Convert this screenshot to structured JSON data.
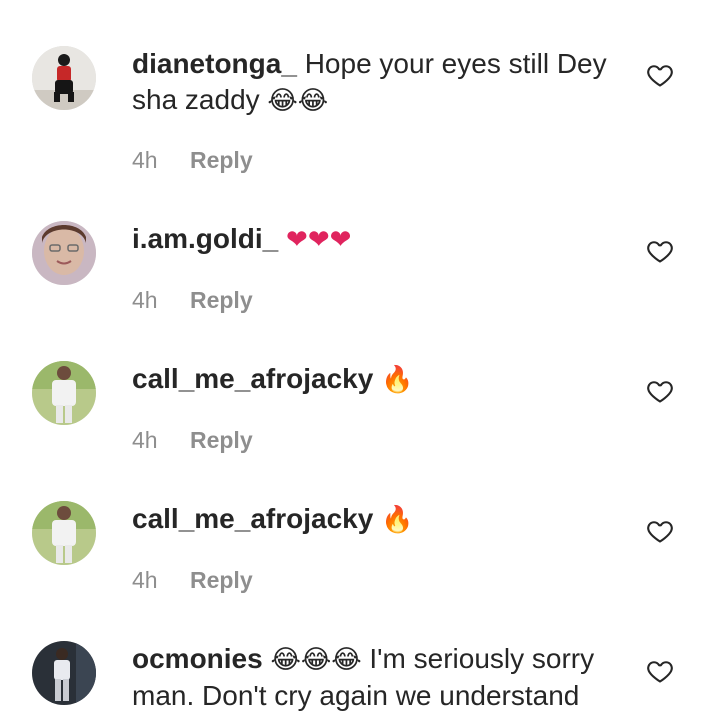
{
  "comments": [
    {
      "username": "dianetonga_",
      "text": "Hope your eyes still Dey sha zaddy",
      "emoji": "😂😂",
      "time": "4h",
      "reply": "Reply"
    },
    {
      "username": "i.am.goldi_",
      "text": "",
      "emoji": "❤❤❤",
      "time": "4h",
      "reply": "Reply"
    },
    {
      "username": "call_me_afrojacky",
      "text": "",
      "emoji": "🔥",
      "time": "4h",
      "reply": "Reply"
    },
    {
      "username": "call_me_afrojacky",
      "text": "",
      "emoji": "🔥",
      "time": "4h",
      "reply": "Reply"
    },
    {
      "username": "ocmonies",
      "text": "I'm seriously sorry man. Don't cry again we understand",
      "emoji": "😂😂😂",
      "time": "",
      "reply": ""
    }
  ],
  "icons": {
    "like": "heart-outline-icon"
  },
  "colors": {
    "heart_red": "#e0245e",
    "fire": "#f59e0b",
    "muted": "#8e8e8e"
  }
}
